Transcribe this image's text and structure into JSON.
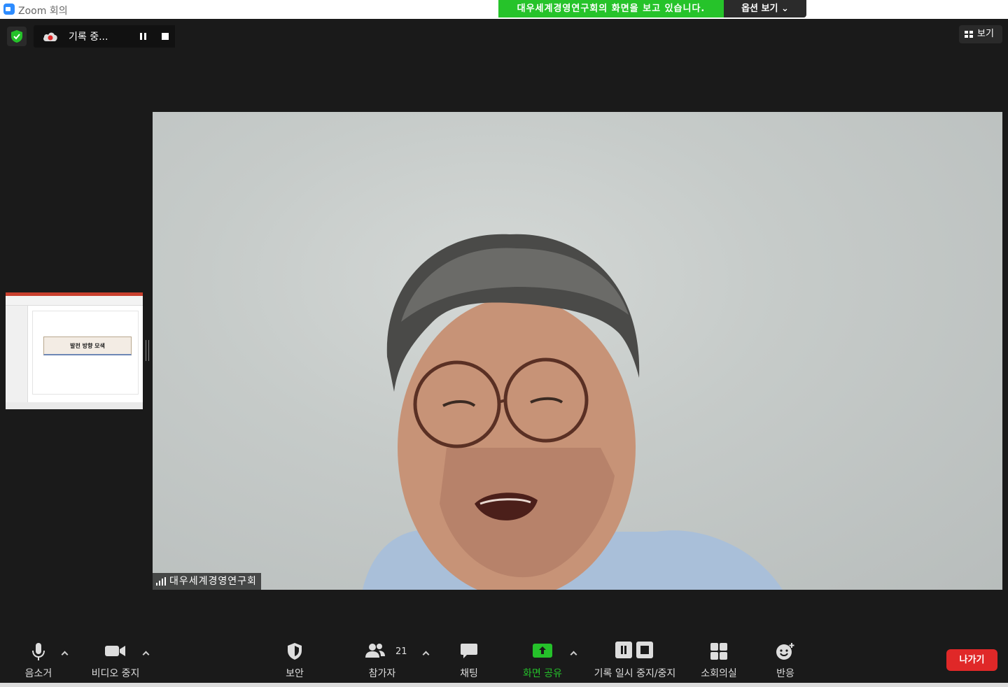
{
  "window": {
    "title": "Zoom 회의"
  },
  "share_banner": {
    "message": "대우세계경영연구회의 화면을 보고 있습니다.",
    "options_label": "옵션 보기"
  },
  "recording": {
    "status": "기록 중..."
  },
  "view": {
    "label": "보기"
  },
  "main_video": {
    "participant_name": "대우세계경영연구회"
  },
  "shared_thumbnail": {
    "slide_title": "발전 방향 모색"
  },
  "toolbar": {
    "mute": "음소거",
    "video_stop": "비디오 중지",
    "security": "보안",
    "participants": "참가자",
    "participant_count": "21",
    "chat": "채팅",
    "share_screen": "화면 공유",
    "record_pause_stop": "기록 일시 중지/중지",
    "breakout_rooms": "소회의실",
    "reactions": "반응",
    "leave": "나가기"
  },
  "colors": {
    "share_green": "#26c32a",
    "leave_red": "#e02828",
    "accent_blue": "#2d8cff"
  }
}
